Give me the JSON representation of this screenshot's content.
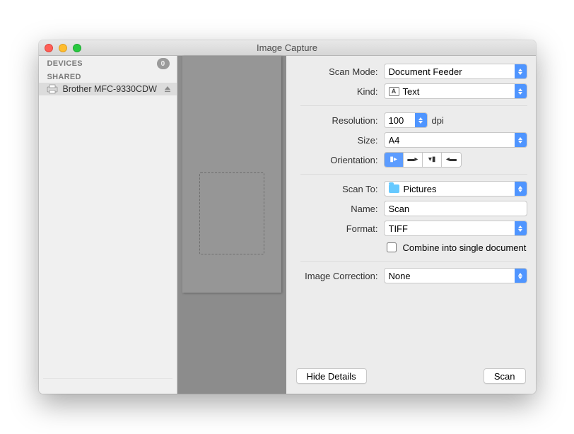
{
  "window": {
    "title": "Image Capture"
  },
  "sidebar": {
    "devices_header": "DEVICES",
    "devices_count": "0",
    "shared_header": "SHARED",
    "device_name": "Brother MFC-9330CDW"
  },
  "fields": {
    "scan_mode": {
      "label": "Scan Mode:",
      "value": "Document Feeder"
    },
    "kind": {
      "label": "Kind:",
      "value": "Text",
      "icon_letter": "A"
    },
    "resolution": {
      "label": "Resolution:",
      "value": "100",
      "unit": "dpi"
    },
    "size": {
      "label": "Size:",
      "value": "A4"
    },
    "orientation": {
      "label": "Orientation:"
    },
    "scan_to": {
      "label": "Scan To:",
      "value": "Pictures"
    },
    "name": {
      "label": "Name:",
      "value": "Scan"
    },
    "format": {
      "label": "Format:",
      "value": "TIFF"
    },
    "combine": {
      "label": "Combine into single document"
    },
    "image_correction": {
      "label": "Image Correction:",
      "value": "None"
    }
  },
  "footer": {
    "hide_details": "Hide Details",
    "scan": "Scan"
  }
}
